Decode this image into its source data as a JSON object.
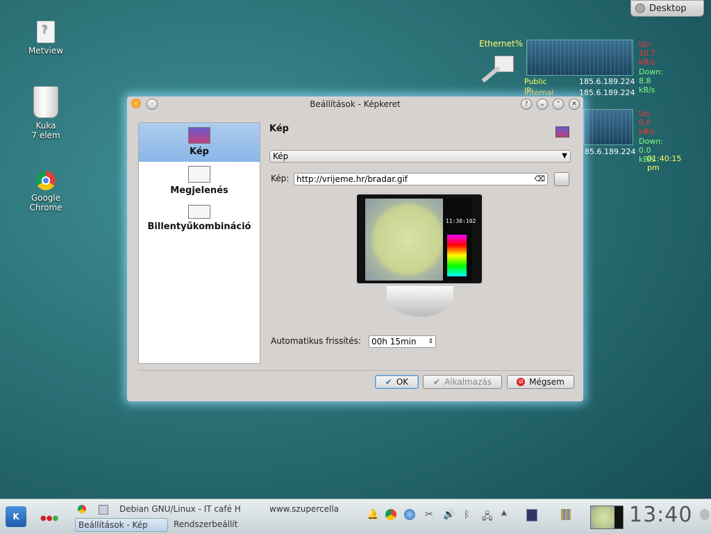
{
  "desktop": {
    "icons": [
      {
        "label": "Metview"
      },
      {
        "label": "Kuka",
        "sub": "7 elem"
      },
      {
        "label": "Google",
        "sub": "Chrome"
      }
    ],
    "desktop_button": "Desktop"
  },
  "network": {
    "ethernet_label": "Ethernet%",
    "up1": "Up: 10.7 kB/s",
    "down1": "Down: 8.8 kB/s",
    "public_ip_label": "Public  IP:",
    "public_ip": "185.6.189.224",
    "internal_ip_label": "Internal IP:",
    "internal_ip": "185.6.189.224",
    "up2": "Up: 0.0 kB/s",
    "down2": "Down: 0.0 kB/s",
    "ip2": "85.6.189.224",
    "time": "01:40:15 pm"
  },
  "window": {
    "title": "Beállítások - Képkeret",
    "sidebar": [
      {
        "label": "Kép"
      },
      {
        "label": "Megjelenés"
      },
      {
        "label": "Billentyűkombináció"
      }
    ],
    "section_title": "Kép",
    "combo_value": "Kép",
    "image_label": "Kép:",
    "image_url": "http://vrijeme.hr/bradar.gif",
    "preview_time": "11:30:102",
    "refresh_label": "Automatikus frissítés:",
    "refresh_value": "00h 15min",
    "buttons": {
      "ok": "OK",
      "apply": "Alkalmazás",
      "cancel": "Mégsem"
    }
  },
  "taskbar": {
    "tasks_top": [
      "Debian GNU/Linux - IT café H",
      "www.szupercella"
    ],
    "tasks_bottom": [
      "Beállítások - Kép",
      "Rendszerbeállít"
    ],
    "clock": "13:40"
  },
  "colors": {
    "up": "#ff3030",
    "down": "#80ff80",
    "public": "#ffff60",
    "internal": "#ffd040",
    "highlight": "#8ab6e6"
  }
}
